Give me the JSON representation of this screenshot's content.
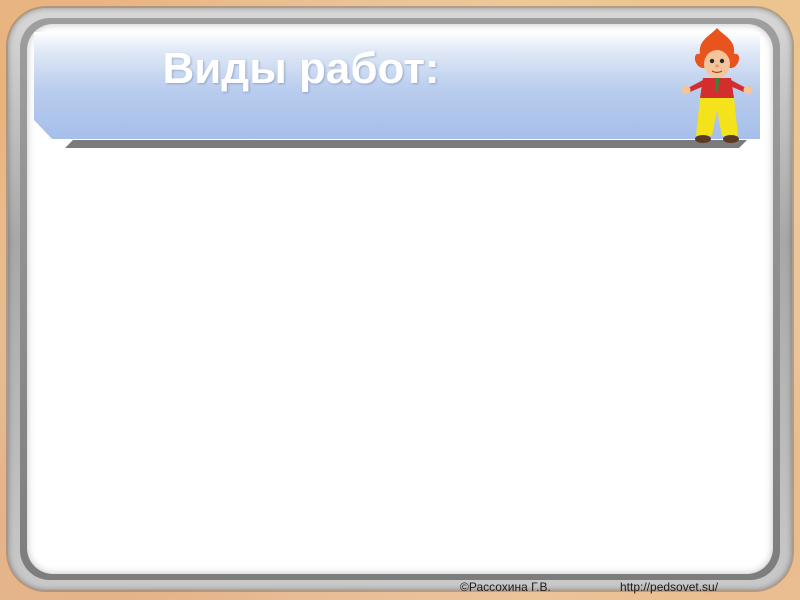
{
  "slide": {
    "title": "Виды работ:",
    "body_text": ""
  },
  "footer": {
    "copyright": "©Рассохина Г.В.",
    "url": "http://pedsovet.su/"
  },
  "icons": {
    "mascot": "cartoon-boy-mascot-icon"
  },
  "colors": {
    "title_bar_top": "#ffffff",
    "title_bar_bottom": "#a6bfe9",
    "title_text": "#ffffff",
    "content_background": "#ffffff",
    "frame": "#9e9e9e"
  }
}
